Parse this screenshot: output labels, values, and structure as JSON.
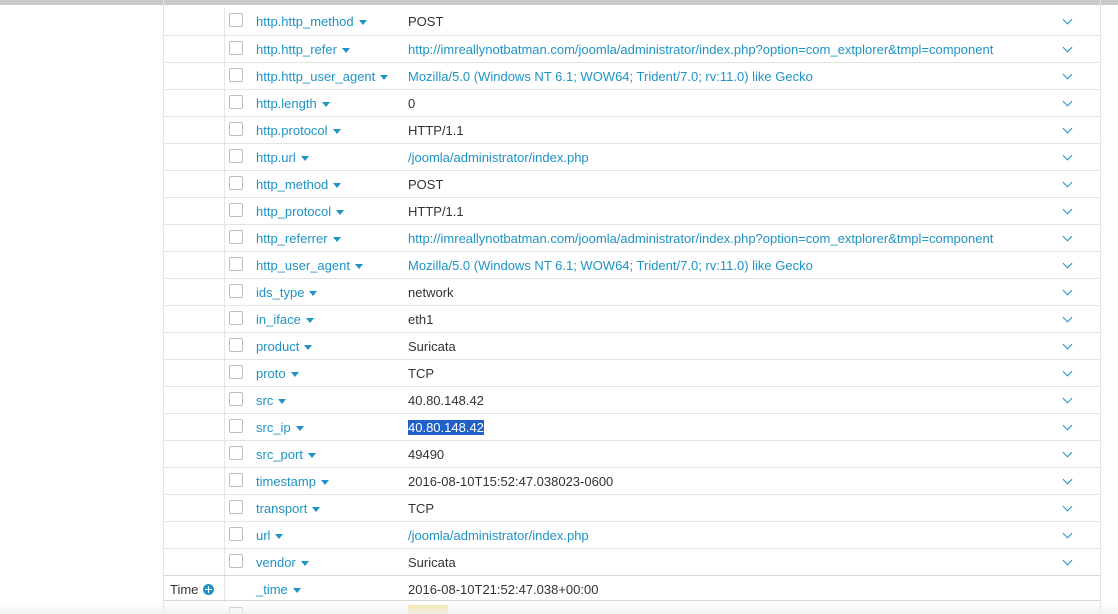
{
  "fields": [
    {
      "name": "http.http_method",
      "value": "POST",
      "value_link": false
    },
    {
      "name": "http.http_refer",
      "value": "http://imreallynotbatman.com/joomla/administrator/index.php?option=com_extplorer&tmpl=component",
      "value_link": true
    },
    {
      "name": "http.http_user_agent",
      "value": "Mozilla/5.0 (Windows NT 6.1; WOW64; Trident/7.0; rv:11.0) like Gecko",
      "value_link": true
    },
    {
      "name": "http.length",
      "value": "0",
      "value_link": false
    },
    {
      "name": "http.protocol",
      "value": "HTTP/1.1",
      "value_link": false
    },
    {
      "name": "http.url",
      "value": "/joomla/administrator/index.php",
      "value_link": true
    },
    {
      "name": "http_method",
      "value": "POST",
      "value_link": false
    },
    {
      "name": "http_protocol",
      "value": "HTTP/1.1",
      "value_link": false
    },
    {
      "name": "http_referrer",
      "value": "http://imreallynotbatman.com/joomla/administrator/index.php?option=com_extplorer&tmpl=component",
      "value_link": true
    },
    {
      "name": "http_user_agent",
      "value": "Mozilla/5.0 (Windows NT 6.1; WOW64; Trident/7.0; rv:11.0) like Gecko",
      "value_link": true
    },
    {
      "name": "ids_type",
      "value": "network",
      "value_link": false
    },
    {
      "name": "in_iface",
      "value": "eth1",
      "value_link": false
    },
    {
      "name": "product",
      "value": "Suricata",
      "value_link": false
    },
    {
      "name": "proto",
      "value": "TCP",
      "value_link": false
    },
    {
      "name": "src",
      "value": "40.80.148.42",
      "value_link": false
    },
    {
      "name": "src_ip",
      "value": "40.80.148.42",
      "value_link": false,
      "selected": true
    },
    {
      "name": "src_port",
      "value": "49490",
      "value_link": false
    },
    {
      "name": "timestamp",
      "value": "2016-08-10T15:52:47.038023-0600",
      "value_link": false
    },
    {
      "name": "transport",
      "value": "TCP",
      "value_link": false
    },
    {
      "name": "url",
      "value": "/joomla/administrator/index.php",
      "value_link": true
    },
    {
      "name": "vendor",
      "value": "Suricata",
      "value_link": false
    }
  ],
  "time_group": {
    "label": "Time",
    "icon": "plus-circle-icon",
    "field": "_time",
    "value": "2016-08-10T21:52:47.038+00:00"
  },
  "colors": {
    "link": "#1e93c6",
    "selection": "#1f60c9",
    "text": "#333333"
  }
}
